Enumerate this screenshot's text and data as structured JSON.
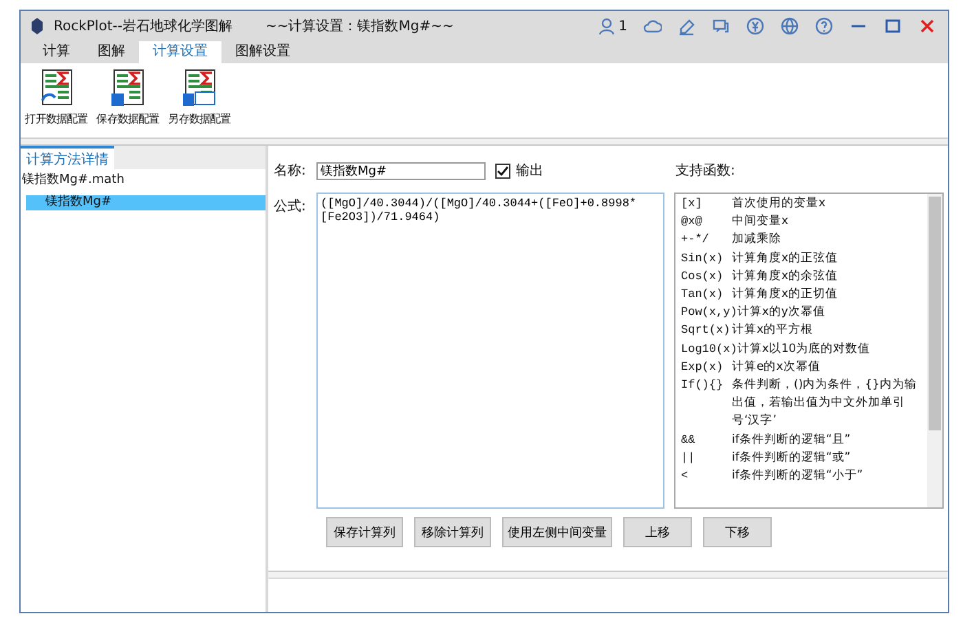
{
  "window": {
    "title": "RockPlot--岩石地球化学图解",
    "subtitle": "~~计算设置：镁指数Mg#~~",
    "user_count": "1"
  },
  "tabs": [
    {
      "label": "计算",
      "selected": false
    },
    {
      "label": "图解",
      "selected": false
    },
    {
      "label": "计算设置",
      "selected": true
    },
    {
      "label": "图解设置",
      "selected": false
    }
  ],
  "ribbon": [
    {
      "label": "打开数据配置",
      "kind": "open"
    },
    {
      "label": "保存数据配置",
      "kind": "save"
    },
    {
      "label": "另存数据配置",
      "kind": "saveas"
    }
  ],
  "sidebar": {
    "tab": "计算方法详情",
    "file": "镁指数Mg#.math",
    "items": [
      {
        "label": "镁指数Mg#",
        "selected": true
      }
    ]
  },
  "form": {
    "name_label": "名称:",
    "name_value": "镁指数Mg#",
    "output_label": "输出",
    "output_checked": true,
    "formula_label": "公式:",
    "formula_value": "([MgO]/40.3044)/([MgO]/40.3044+([FeO]+0.8998*[Fe2O3])/71.9464)",
    "functions_label": "支持函数:"
  },
  "functions": [
    {
      "symbol": "[x]",
      "description": "首次使用的变量x"
    },
    {
      "symbol": "@x@",
      "description": "中间变量x"
    },
    {
      "symbol": "+-*/",
      "description": "加减乘除"
    },
    {
      "symbol": "Sin(x)",
      "description": "计算角度x的正弦值"
    },
    {
      "symbol": "Cos(x)",
      "description": "计算角度x的余弦值"
    },
    {
      "symbol": "Tan(x)",
      "description": "计算角度x的正切值"
    },
    {
      "symbol": "Pow(x,y)",
      "description": "计算x的y次幂值"
    },
    {
      "symbol": "Sqrt(x)",
      "description": "计算x的平方根"
    },
    {
      "symbol": "Log10(x)",
      "description": "计算x以10为底的对数值"
    },
    {
      "symbol": "Exp(x)",
      "description": "计算e的x次幂值"
    },
    {
      "symbol": "If(){}",
      "description": "条件判断，()内为条件，{}内为输出值，若输出值为中文外加单引号‘汉字’"
    },
    {
      "symbol": "&&",
      "description": "if条件判断的逻辑“且”"
    },
    {
      "symbol": "||",
      "description": "if条件判断的逻辑“或”"
    },
    {
      "symbol": "<",
      "description": "if条件判断的逻辑“小于”"
    }
  ],
  "buttons": [
    {
      "label": "保存计算列",
      "kind": "wide"
    },
    {
      "label": "移除计算列",
      "kind": "wide"
    },
    {
      "label": "使用左侧中间变量",
      "kind": "wide"
    },
    {
      "label": "上移",
      "kind": "move"
    },
    {
      "label": "下移",
      "kind": "move"
    }
  ]
}
